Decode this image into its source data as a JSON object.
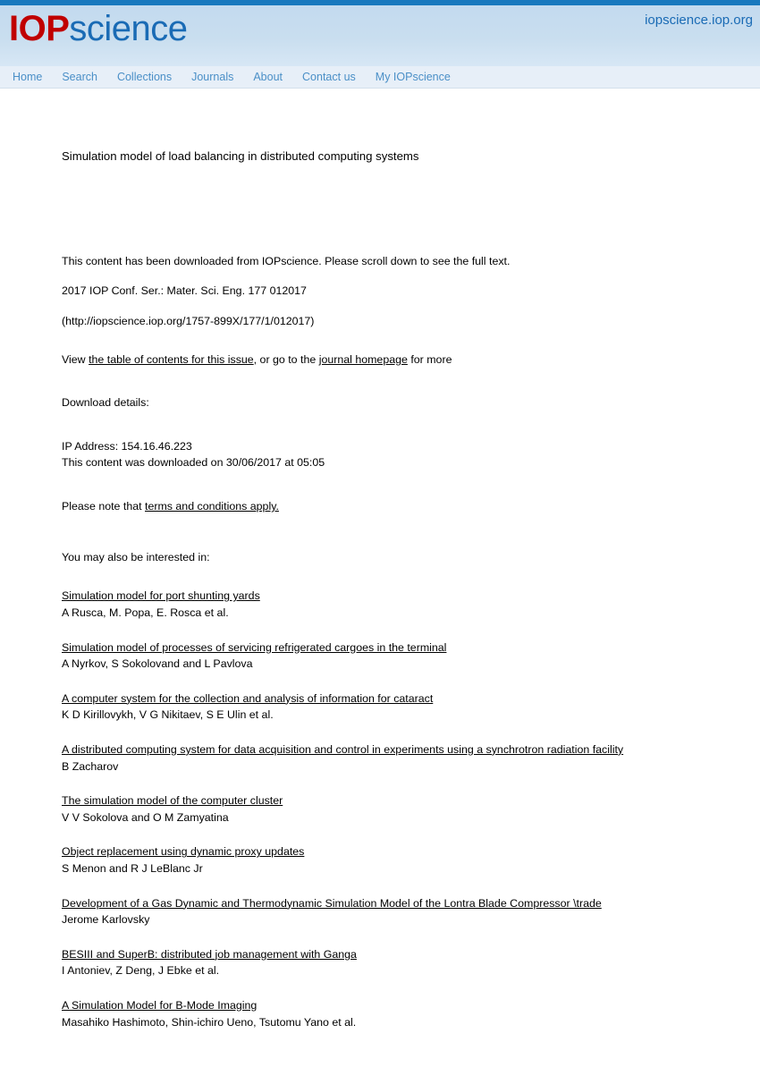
{
  "header": {
    "brand_iop": "IOP",
    "brand_science": "science",
    "site_url": "iopscience.iop.org",
    "nav": [
      {
        "label": "Home"
      },
      {
        "label": "Search"
      },
      {
        "label": "Collections"
      },
      {
        "label": "Journals"
      },
      {
        "label": "About"
      },
      {
        "label": "Contact us"
      },
      {
        "label": "My IOPscience"
      }
    ],
    "colors": {
      "top_rule": "#1878be",
      "band_top": "#c3daef",
      "band_bottom": "#d7e7f5",
      "nav_background": "#e7eff8",
      "nav_link": "#4a8fc7",
      "brand_red": "#c00000",
      "brand_blue": "#1a6bb5"
    }
  },
  "article": {
    "title": "Simulation model of load balancing in distributed computing systems",
    "downloaded_notice": "This content has been downloaded from IOPscience. Please scroll down to see the full text.",
    "citation": "2017 IOP Conf. Ser.: Mater. Sci. Eng. 177 012017",
    "doi_url": "(http://iopscience.iop.org/1757-899X/177/1/012017)",
    "view_prefix": "View ",
    "view_toc_link": "the table of contents for this issue",
    "view_middle": ", or go to the ",
    "view_journal_link": "journal homepage",
    "view_suffix": " for more"
  },
  "download_details": {
    "heading": "Download details:",
    "ip_address": "IP Address: 154.16.46.223",
    "downloaded_on": "This content was downloaded on 30/06/2017 at 05:05",
    "terms_prefix": "Please note that ",
    "terms_link": "terms and conditions apply."
  },
  "related": {
    "heading": "You may also be interested in:",
    "items": [
      {
        "title": "Simulation model for port shunting yards",
        "authors": "A Rusca, M. Popa, E. Rosca et al."
      },
      {
        "title": "Simulation model of processes of servicing refrigerated cargoes in the terminal",
        "authors": "A Nyrkov, S Sokolovand and L Pavlova"
      },
      {
        "title": "A computer system for the collection and analysis of information for cataract",
        "authors": "K D Kirillovykh, V G Nikitaev, S E Ulin et al."
      },
      {
        "title": "A distributed computing system for data acquisition and control in experiments using a synchrotron radiation facility",
        "authors": "B Zacharov"
      },
      {
        "title": "The simulation model of the computer cluster",
        "authors": "V V Sokolova and O M Zamyatina"
      },
      {
        "title": "Object replacement using dynamic proxy updates",
        "authors": "S Menon and R J LeBlanc Jr"
      },
      {
        "title": "Development of a Gas Dynamic and Thermodynamic Simulation Model of the Lontra Blade Compressor \\trade",
        "authors": "Jerome Karlovsky"
      },
      {
        "title": "BESIII and SuperB: distributed job management with Ganga",
        "authors": "I Antoniev, Z Deng, J Ebke et al."
      },
      {
        "title": "A Simulation Model for B-Mode Imaging",
        "authors": "Masahiko Hashimoto, Shin-ichiro Ueno, Tsutomu Yano et al."
      }
    ]
  }
}
